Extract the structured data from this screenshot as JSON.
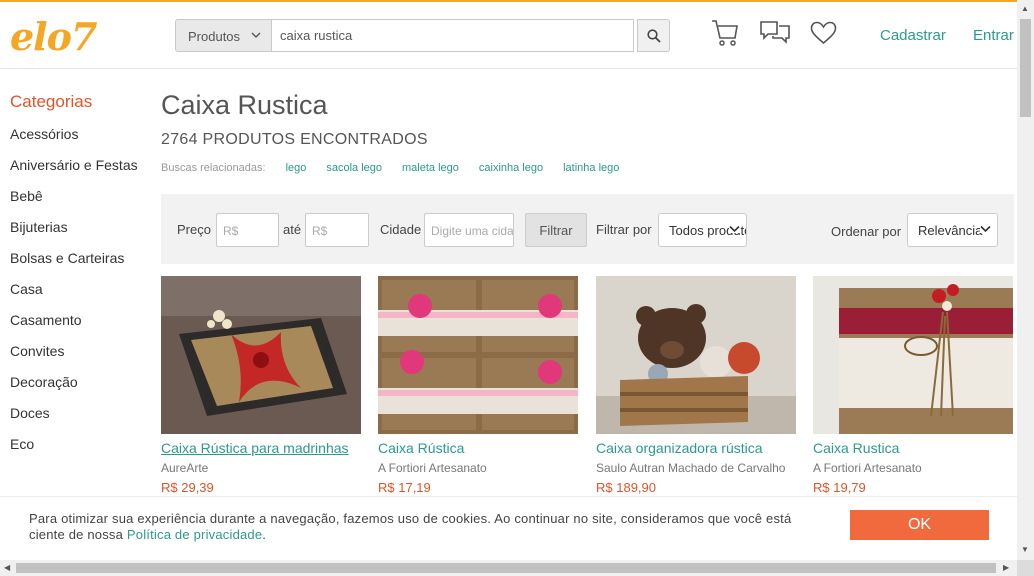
{
  "header": {
    "logo": "elo7",
    "search_category": "Produtos",
    "search_value": "caixa rustica",
    "links": {
      "register": "Cadastrar",
      "login": "Entrar"
    }
  },
  "sidebar": {
    "title": "Categorias",
    "items": [
      {
        "label": "Acessórios"
      },
      {
        "label": "Aniversário e Festas"
      },
      {
        "label": "Bebê"
      },
      {
        "label": "Bijuterias"
      },
      {
        "label": "Bolsas e Carteiras"
      },
      {
        "label": "Casa"
      },
      {
        "label": "Casamento"
      },
      {
        "label": "Convites"
      },
      {
        "label": "Decoração"
      },
      {
        "label": "Doces"
      },
      {
        "label": "Eco"
      }
    ]
  },
  "main": {
    "title": "Caixa Rustica",
    "count": "2764 PRODUTOS ENCONTRADOS",
    "related_label": "Buscas relacionadas:",
    "related": [
      "lego",
      "sacola lego",
      "maleta lego",
      "caixinha lego",
      "latinha lego"
    ]
  },
  "filters": {
    "price_label": "Preço",
    "price_min_placeholder": "R$",
    "price_to": "até",
    "price_max_placeholder": "R$",
    "city_label": "Cidade",
    "city_placeholder": "Digite uma cidade",
    "filter_button": "Filtrar",
    "filter_by_label": "Filtrar por",
    "filter_by_value": "Todos produtos",
    "sort_label": "Ordenar por",
    "sort_value": "Relevância"
  },
  "products": [
    {
      "name": "Caixa Rústica para madrinhas",
      "seller": "AureArte",
      "price": "R$ 29,39"
    },
    {
      "name": "Caixa Rústica",
      "seller": "A Fortiori Artesanato",
      "price": "R$ 17,19"
    },
    {
      "name": "Caixa organizadora rústica",
      "seller": "Saulo Autran Machado de Carvalho",
      "price": "R$ 189,90"
    },
    {
      "name": "Caixa Rustica",
      "seller": "A Fortiori Artesanato",
      "price": "R$ 19,79"
    }
  ],
  "cookie": {
    "text": "Para otimizar sua experiência durante a navegação, fazemos uso de cookies. Ao continuar no site, consideramos que você está ciente de nossa ",
    "link": "Política de privacidade",
    "end": ".",
    "ok": "OK"
  },
  "colors": {
    "brand": "#f5a623",
    "accent_link": "#2b9a8c",
    "category_title": "#e0542a",
    "ok_button": "#f06a3e"
  }
}
